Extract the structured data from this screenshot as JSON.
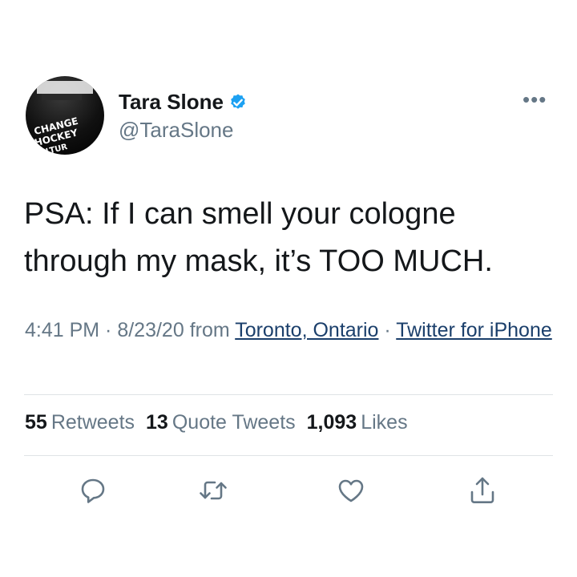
{
  "author": {
    "name": "Tara Slone",
    "handle": "@TaraSlone",
    "avatar_text": [
      "CHANGE",
      "HOCKEY",
      "ULTUR"
    ],
    "verified_icon": "verified-badge-icon"
  },
  "menu": {
    "more_label": "•••"
  },
  "tweet": {
    "text": "PSA: If I can smell your cologne\nthrough my mask, it’s TOO MUCH."
  },
  "meta": {
    "time": "4:41 PM",
    "sep1": " · ",
    "date": "8/23/20",
    "from": " from ",
    "location": "Toronto, Ontario",
    "sep2": " · ",
    "source": "Twitter for iPhone"
  },
  "stats": {
    "retweets_count": "55",
    "retweets_label": "Retweets",
    "quotes_count": "13",
    "quotes_label": "Quote Tweets",
    "likes_count": "1,093",
    "likes_label": "Likes"
  },
  "actions": [
    "reply-icon",
    "retweet-icon",
    "like-icon",
    "share-icon"
  ],
  "colors": {
    "text": "#14171a",
    "secondary": "#657786",
    "link": "#1b3f6b",
    "verified": "#1da1f2",
    "divider": "#dfe3e6"
  }
}
